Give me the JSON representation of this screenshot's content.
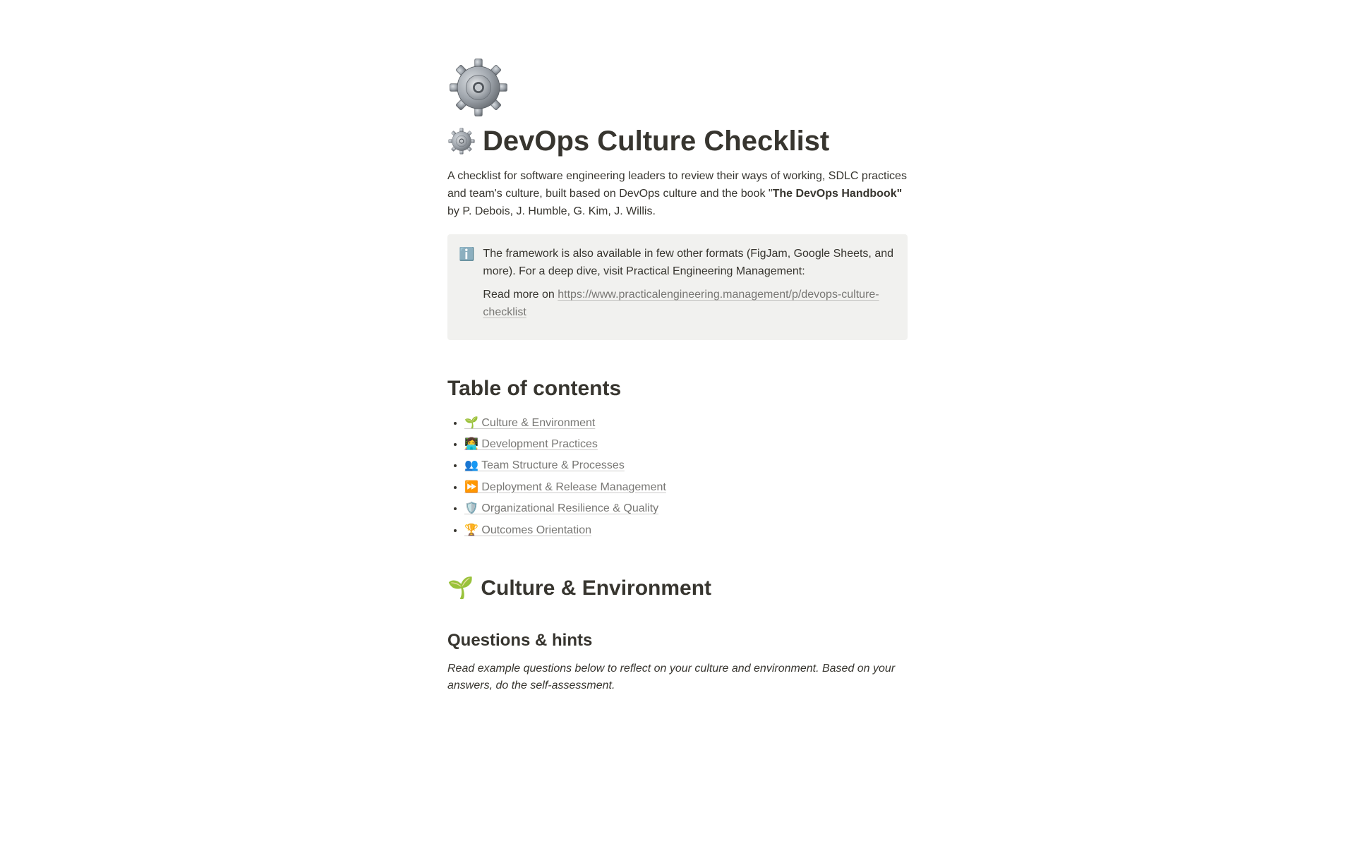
{
  "page": {
    "title": "DevOps Culture Checklist",
    "icon_name": "gear"
  },
  "intro": {
    "pre": "A checklist for software engineering leaders to review their ways of working, SDLC practices and team's culture, built based on DevOps culture and the book \"",
    "bold": "The DevOps Handbook\"",
    "post": " by P. Debois, J. Humble, G. Kim, J. Willis."
  },
  "callout": {
    "icon": "ℹ️",
    "line1": "The framework is also available in few other formats (FigJam, Google Sheets, and more). For a deep dive, visit Practical Engineering Management:",
    "line2_prefix": "Read more on ",
    "link_text": "https://www.practicalengineering.management/p/devops-culture-checklist"
  },
  "toc": {
    "title": "Table of contents",
    "items": [
      {
        "emoji": "🌱",
        "label": "Culture & Environment"
      },
      {
        "emoji": "👩‍💻",
        "label": "Development Practices"
      },
      {
        "emoji": "👥",
        "label": "Team Structure & Processes"
      },
      {
        "emoji": "⏩",
        "label": "Deployment & Release Management"
      },
      {
        "emoji": "🛡️",
        "label": "Organizational Resilience & Quality"
      },
      {
        "emoji": "🏆",
        "label": "Outcomes Orientation"
      }
    ]
  },
  "section1": {
    "emoji": "🌱",
    "title": "Culture & Environment",
    "subheading": "Questions & hints",
    "hint": "Read example questions below to reflect on your culture and environment. Based on your answers, do the self-assessment."
  }
}
